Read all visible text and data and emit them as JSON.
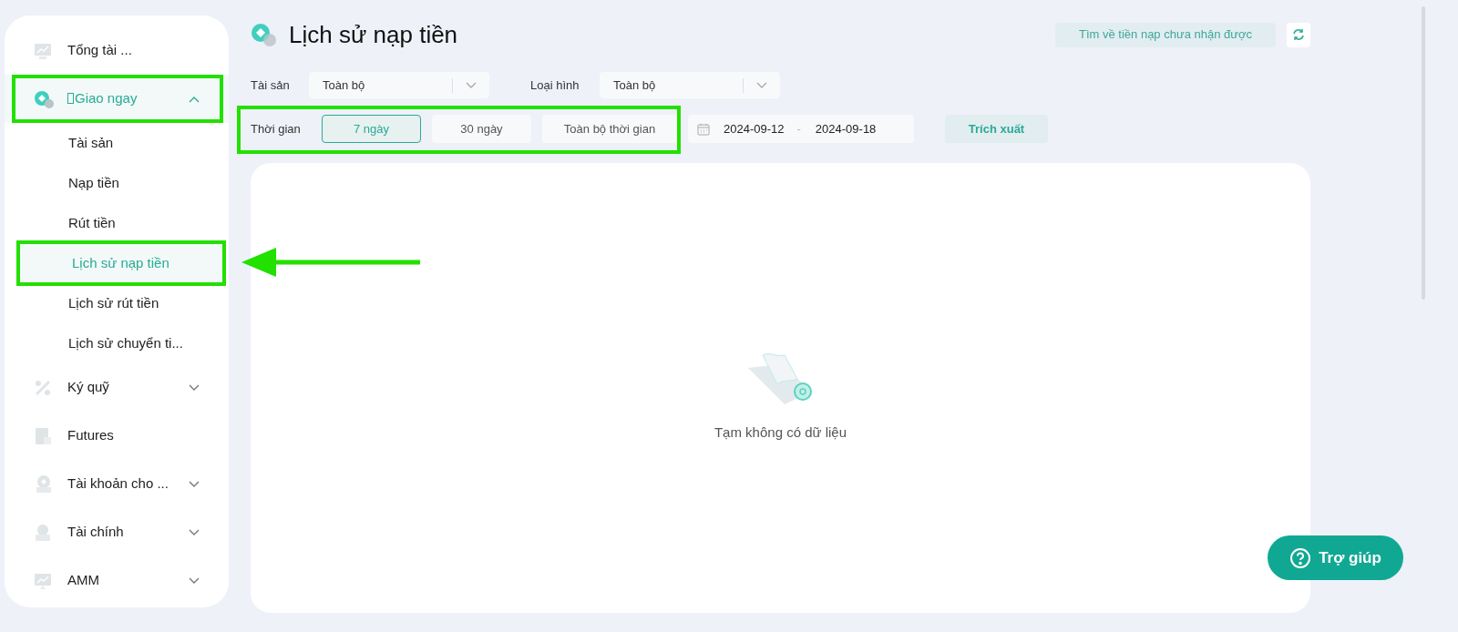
{
  "sidebar": {
    "items": [
      {
        "label": "Tổng tài ...",
        "selected": false,
        "highlighted": false
      },
      {
        "label": "Giao ngay",
        "selected": true,
        "highlighted": true,
        "expanded": true,
        "children": [
          {
            "label": "Tài sản",
            "selected": false,
            "highlighted": false
          },
          {
            "label": "Nạp tiền",
            "selected": false,
            "highlighted": false
          },
          {
            "label": "Rút tiền",
            "selected": false,
            "highlighted": false
          },
          {
            "label": "Lịch sử nạp tiền",
            "selected": true,
            "highlighted": true
          },
          {
            "label": "Lịch sử rút tiền",
            "selected": false,
            "highlighted": false
          },
          {
            "label": "Lịch sử chuyển ti...",
            "selected": false,
            "highlighted": false
          }
        ]
      },
      {
        "label": "Ký quỹ",
        "selected": false,
        "highlighted": false,
        "expanded": false
      },
      {
        "label": "Futures",
        "selected": false,
        "highlighted": false
      },
      {
        "label": "Tài khoản cho ...",
        "selected": false,
        "highlighted": false,
        "expanded": false
      },
      {
        "label": "Tài chính",
        "selected": false,
        "highlighted": false,
        "expanded": false
      },
      {
        "label": "AMM",
        "selected": false,
        "highlighted": false,
        "expanded": false
      }
    ]
  },
  "page": {
    "title": "Lịch sử nạp tiền",
    "find_button": "Tìm về tiền nạp chưa nhận được"
  },
  "filters": [
    {
      "label": "Tài sản",
      "value": "Toàn bộ"
    },
    {
      "label": "Loại hình",
      "value": "Toàn bộ"
    }
  ],
  "time_filter": {
    "label": "Thời gian",
    "highlighted": true,
    "options": [
      {
        "label": "7 ngày",
        "selected": true
      },
      {
        "label": "30 ngày",
        "selected": false
      },
      {
        "label": "Toàn bộ thời gian",
        "selected": false
      }
    ],
    "start_date": "2024-09-12",
    "separator": "-",
    "end_date": "2024-09-18",
    "export_button": "Trích xuất"
  },
  "empty_state": "Tạm không có dữ liệu",
  "help_button": "Trợ giúp"
}
